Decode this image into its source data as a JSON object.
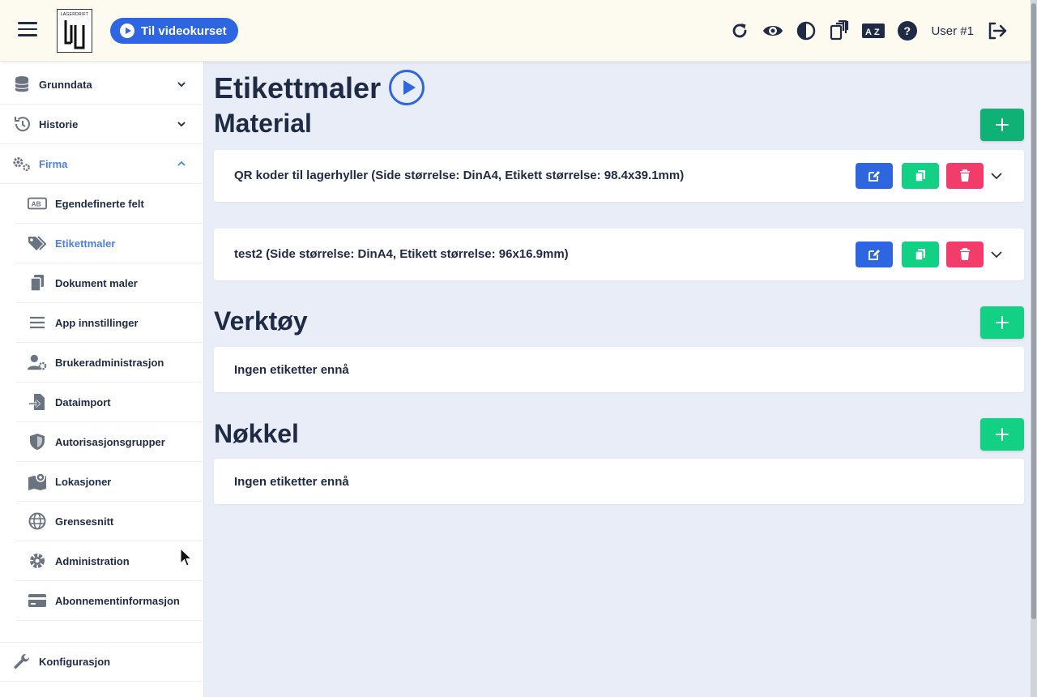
{
  "header": {
    "logo_text": "LAGERDRIFT",
    "video_button_label": "Til videokurset",
    "user_label": "User #1"
  },
  "sidebar": {
    "items": [
      {
        "label": "Grunndata"
      },
      {
        "label": "Historie"
      },
      {
        "label": "Firma"
      },
      {
        "label": "Konfigurasjon"
      }
    ],
    "firma_sub": [
      {
        "label": "Egendefinerte felt"
      },
      {
        "label": "Etikettmaler"
      },
      {
        "label": "Dokument maler"
      },
      {
        "label": "App innstillinger"
      },
      {
        "label": "Brukeradministrasjon"
      },
      {
        "label": "Dataimport"
      },
      {
        "label": "Autorisasjonsgrupper"
      },
      {
        "label": "Lokasjoner"
      },
      {
        "label": "Grensesnitt"
      },
      {
        "label": "Administration"
      },
      {
        "label": "Abonnementinformasjon"
      }
    ],
    "active_item": "Etikettmaler"
  },
  "main": {
    "page_title": "Etikettmaler",
    "sections": [
      {
        "title": "Material",
        "templates": [
          "QR koder til lagerhyller (Side størrelse: DinA4, Etikett størrelse: 98.4x39.1mm)",
          "test2 (Side størrelse: DinA4, Etikett størrelse: 96x16.9mm)"
        ]
      },
      {
        "title": "Verktøy",
        "empty_text": "Ingen etiketter ennå"
      },
      {
        "title": "Nøkkel",
        "empty_text": "Ingen etiketter ennå"
      }
    ]
  },
  "colors": {
    "primary": "#2d66e0",
    "success": "#12d184",
    "danger": "#f23c6a",
    "text": "#1f2a44",
    "header_bg": "#fdfaf0",
    "page_bg": "#e9edf7"
  }
}
